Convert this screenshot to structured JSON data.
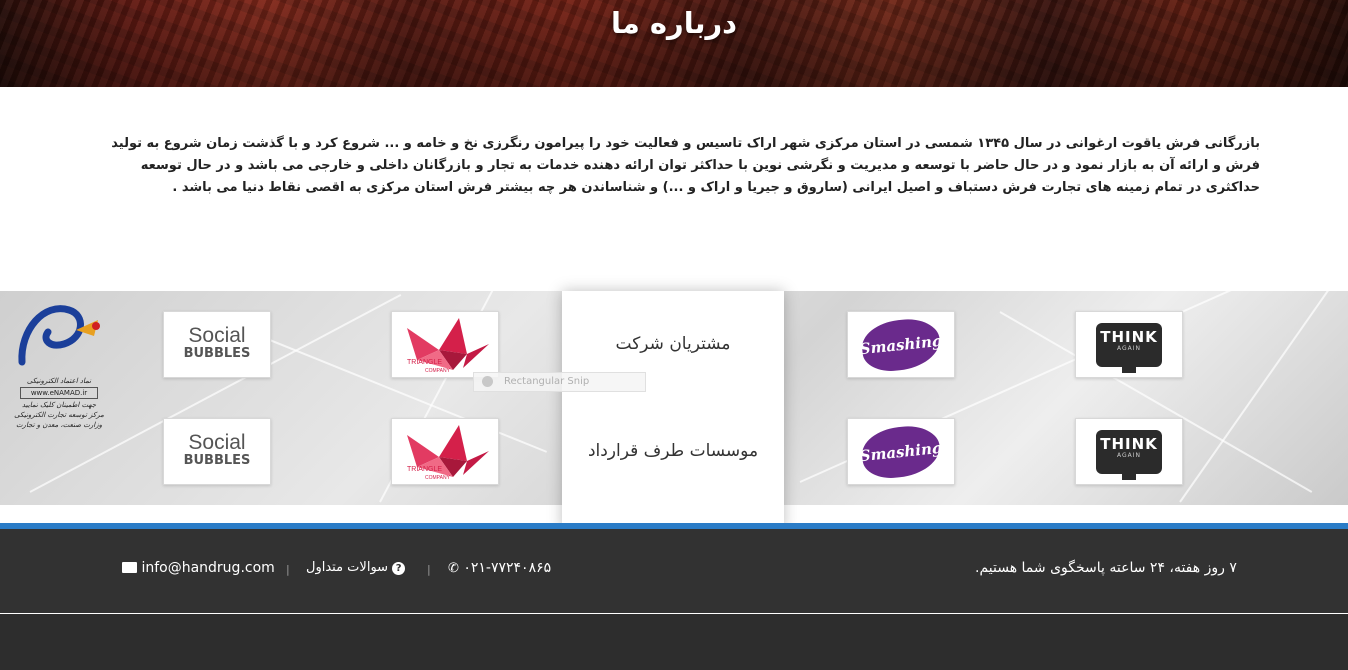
{
  "page": {
    "title": "درباره ما",
    "about_text": "بازرگانی فرش یاقوت ارغوانی در سال ۱۳۴۵ شمسی در استان مرکزی شهر اراک تاسیس و فعالیت خود را پیرامون رنگرزی نخ و خامه و ... شروع کرد و با گذشت زمان شروع به تولید فرش و ارائه آن به بازار نمود و در حال حاضر با توسعه و مدیریت و نگرشی نوین با حداکثر توان ارائه دهنده خدمات به تجار و بازرگانان داخلی و خارجی می باشد و در حال توسعه حداکثری در تمام زمینه های تجارت فرش دستباف و اصیل ایرانی (ساروق و جیریا و اراک و ...) و شناساندن هر چه بیشتر فرش استان مرکزی به اقصی نقاط دنیا می باشد ."
  },
  "partners": {
    "customers_label": "مشتریان شرکت",
    "contractors_label": "موسسات طرف قرارداد",
    "logos": {
      "think": {
        "line1": "THINK",
        "line2": "AGAIN"
      },
      "smashing": "Smashing",
      "triangle": {
        "line1": "TRIANGLE",
        "line2": "COMPANY"
      },
      "social": {
        "line1": "Social",
        "line2": "BUBBLES"
      }
    }
  },
  "snip_overlay": "Rectangular Snip",
  "enamad": {
    "line1": "نماد اعتماد الکترونیکی",
    "url": "www.eNAMAD.ir",
    "line2": "جهت اطمینان کلیک نمایید",
    "line3": "مرکز توسعه تجارت الکترونیکی",
    "line4": "وزارت صنعت، معدن و تجارت"
  },
  "footer": {
    "hours": "۷ روز هفته، ۲۴ ساعته پاسخگوی شما هستیم.",
    "phone": "۰۲۱-۷۷۲۴۰۸۶۵",
    "faq": "سوالات متداول",
    "email": "info@handrug.com",
    "separator": "|"
  },
  "colors": {
    "accent_blue": "#2a7cc7",
    "footer_bg": "#323232",
    "smashing_purple": "#6a2a8c",
    "triangle_red": "#d4204a"
  }
}
